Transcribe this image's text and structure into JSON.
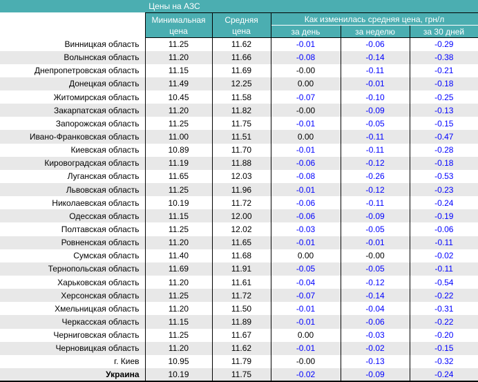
{
  "title": "Цены на АЗС",
  "header": {
    "min_line1": "Минимальная",
    "min_line2": "цена",
    "avg_line1": "Средняя",
    "avg_line2": "цена",
    "change_group": "Как изменилась средняя цена, грн/л",
    "day": "за день",
    "week": "за неделю",
    "month": "за 30 дней"
  },
  "colors": {
    "teal": "#4BAEB1",
    "stripe": "#E8E8E8",
    "negative": "#0000FF",
    "text": "#000000",
    "header_text": "#FFFFFF"
  },
  "rows": [
    {
      "name": "Винницкая область",
      "min": "11.25",
      "avg": "11.62",
      "day": "-0.01",
      "week": "-0.06",
      "month": "-0.29",
      "bold": false
    },
    {
      "name": "Волынская область",
      "min": "11.20",
      "avg": "11.66",
      "day": "-0.08",
      "week": "-0.14",
      "month": "-0.38",
      "bold": false
    },
    {
      "name": "Днепропетровская область",
      "min": "11.15",
      "avg": "11.69",
      "day": "-0.00",
      "week": "-0.11",
      "month": "-0.21",
      "bold": false
    },
    {
      "name": "Донецкая область",
      "min": "11.49",
      "avg": "12.25",
      "day": "0.00",
      "week": "-0.01",
      "month": "-0.18",
      "bold": false
    },
    {
      "name": "Житомирская область",
      "min": "10.45",
      "avg": "11.58",
      "day": "-0.07",
      "week": "-0.10",
      "month": "-0.25",
      "bold": false
    },
    {
      "name": "Закарпатская область",
      "min": "11.20",
      "avg": "11.82",
      "day": "-0.00",
      "week": "-0.09",
      "month": "-0.13",
      "bold": false
    },
    {
      "name": "Запорожская область",
      "min": "11.25",
      "avg": "11.75",
      "day": "-0.01",
      "week": "-0.05",
      "month": "-0.15",
      "bold": false
    },
    {
      "name": "Ивано-Франковская область",
      "min": "11.00",
      "avg": "11.51",
      "day": "0.00",
      "week": "-0.11",
      "month": "-0.47",
      "bold": false
    },
    {
      "name": "Киевская область",
      "min": "10.89",
      "avg": "11.70",
      "day": "-0.01",
      "week": "-0.11",
      "month": "-0.28",
      "bold": false
    },
    {
      "name": "Кировоградская область",
      "min": "11.19",
      "avg": "11.88",
      "day": "-0.06",
      "week": "-0.12",
      "month": "-0.18",
      "bold": false
    },
    {
      "name": "Луганская область",
      "min": "11.65",
      "avg": "12.03",
      "day": "-0.08",
      "week": "-0.26",
      "month": "-0.53",
      "bold": false
    },
    {
      "name": "Львовская область",
      "min": "11.25",
      "avg": "11.96",
      "day": "-0.01",
      "week": "-0.12",
      "month": "-0.23",
      "bold": false
    },
    {
      "name": "Николаевская область",
      "min": "10.19",
      "avg": "11.72",
      "day": "-0.06",
      "week": "-0.11",
      "month": "-0.24",
      "bold": false
    },
    {
      "name": "Одесская область",
      "min": "11.15",
      "avg": "12.00",
      "day": "-0.06",
      "week": "-0.09",
      "month": "-0.19",
      "bold": false
    },
    {
      "name": "Полтавская область",
      "min": "11.25",
      "avg": "12.02",
      "day": "-0.03",
      "week": "-0.05",
      "month": "-0.06",
      "bold": false
    },
    {
      "name": "Ровненская область",
      "min": "11.20",
      "avg": "11.65",
      "day": "-0.01",
      "week": "-0.01",
      "month": "-0.11",
      "bold": false
    },
    {
      "name": "Сумская область",
      "min": "11.40",
      "avg": "11.68",
      "day": "0.00",
      "week": "-0.00",
      "month": "-0.02",
      "bold": false
    },
    {
      "name": "Тернопольская область",
      "min": "11.69",
      "avg": "11.91",
      "day": "-0.05",
      "week": "-0.05",
      "month": "-0.11",
      "bold": false
    },
    {
      "name": "Харьковская область",
      "min": "11.20",
      "avg": "11.61",
      "day": "-0.04",
      "week": "-0.12",
      "month": "-0.54",
      "bold": false
    },
    {
      "name": "Херсонская область",
      "min": "11.25",
      "avg": "11.72",
      "day": "-0.07",
      "week": "-0.14",
      "month": "-0.22",
      "bold": false
    },
    {
      "name": "Хмельницкая область",
      "min": "11.20",
      "avg": "11.50",
      "day": "-0.01",
      "week": "-0.04",
      "month": "-0.31",
      "bold": false
    },
    {
      "name": "Черкасская область",
      "min": "11.15",
      "avg": "11.89",
      "day": "-0.01",
      "week": "-0.06",
      "month": "-0.22",
      "bold": false
    },
    {
      "name": "Черниговская область",
      "min": "11.25",
      "avg": "11.67",
      "day": "0.00",
      "week": "-0.03",
      "month": "-0.20",
      "bold": false
    },
    {
      "name": "Черновицкая область",
      "min": "11.20",
      "avg": "11.62",
      "day": "-0.01",
      "week": "-0.02",
      "month": "-0.15",
      "bold": false
    },
    {
      "name": "г. Киев",
      "min": "10.95",
      "avg": "11.79",
      "day": "-0.00",
      "week": "-0.13",
      "month": "-0.32",
      "bold": false
    },
    {
      "name": "Украина",
      "min": "10.19",
      "avg": "11.75",
      "day": "-0.02",
      "week": "-0.09",
      "month": "-0.24",
      "bold": true
    }
  ]
}
